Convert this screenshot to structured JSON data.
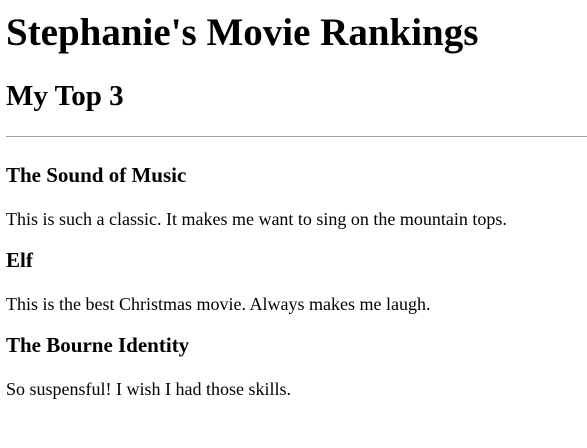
{
  "page": {
    "title": "Stephanie's Movie Rankings",
    "subtitle": "My Top 3"
  },
  "movies": [
    {
      "title": "The Sound of Music",
      "description": "This is such a classic. It makes me want to sing on the mountain tops."
    },
    {
      "title": "Elf",
      "description": "This is the best Christmas movie. Always makes me laugh."
    },
    {
      "title": "The Bourne Identity",
      "description": "So suspensful! I wish I had those skills."
    }
  ]
}
